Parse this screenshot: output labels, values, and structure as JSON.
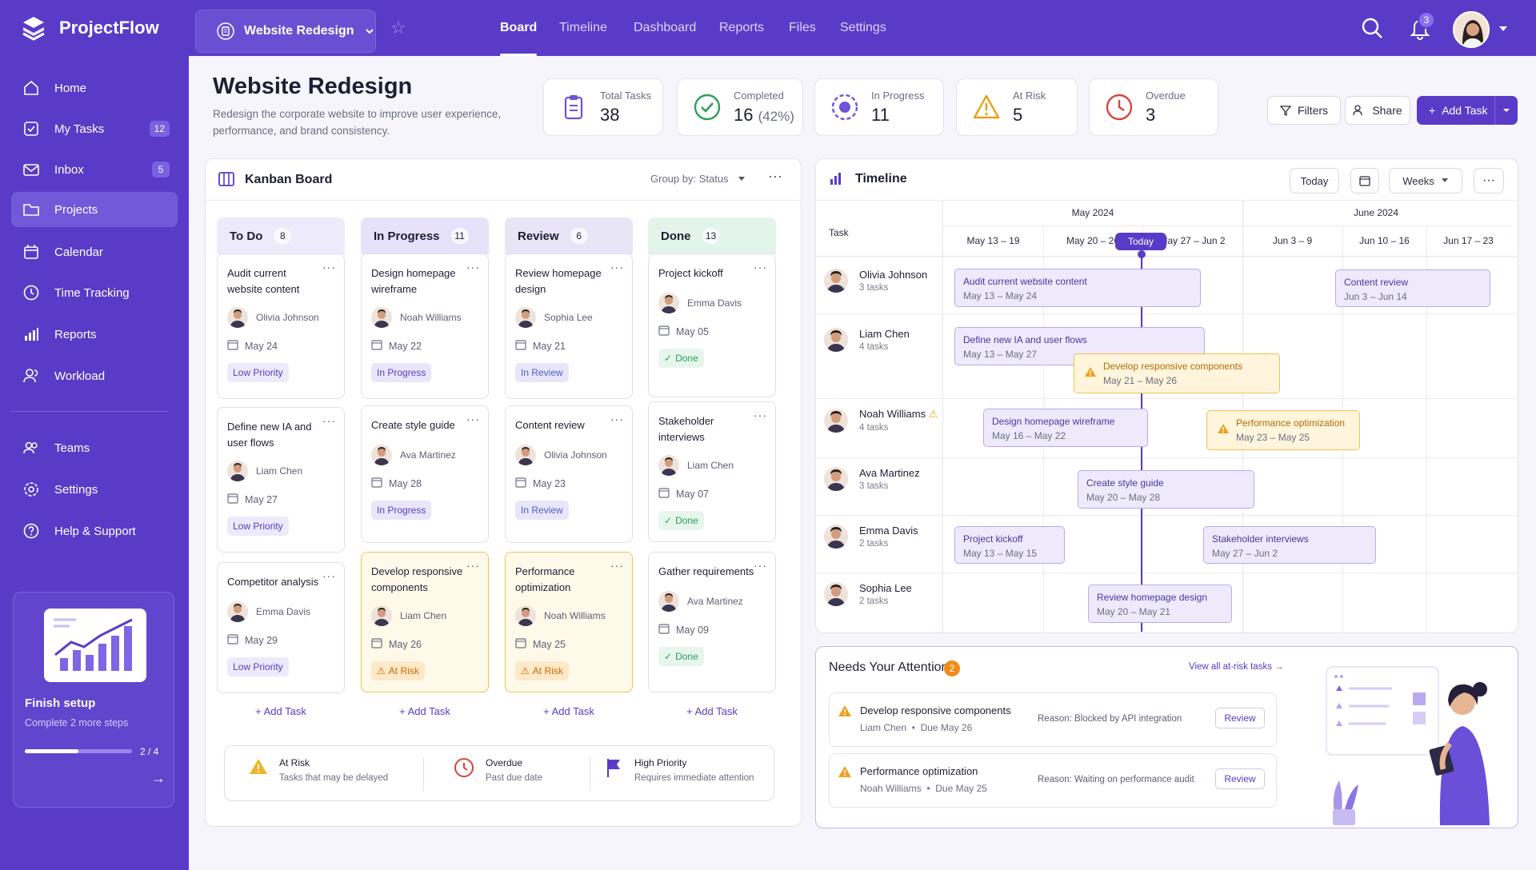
{
  "app": {
    "name": "ProjectFlow",
    "project": "Website Redesign"
  },
  "nav": [
    {
      "label": "Board",
      "active": true
    },
    {
      "label": "Timeline"
    },
    {
      "label": "Dashboard"
    },
    {
      "label": "Reports"
    },
    {
      "label": "Files"
    },
    {
      "label": "Settings"
    }
  ],
  "notifications": {
    "count": "3"
  },
  "sidebar": {
    "items": [
      {
        "label": "Home",
        "icon": "home-icon"
      },
      {
        "label": "My Tasks",
        "icon": "check-square-icon",
        "count": "12"
      },
      {
        "label": "Inbox",
        "icon": "mail-icon",
        "count": "5"
      },
      {
        "label": "Projects",
        "icon": "folder-icon",
        "active": true
      },
      {
        "label": "Calendar",
        "icon": "calendar-icon"
      },
      {
        "label": "Time Tracking",
        "icon": "clock-icon"
      },
      {
        "label": "Reports",
        "icon": "bar-chart-icon"
      },
      {
        "label": "Workload",
        "icon": "users-icon"
      }
    ],
    "secondary": [
      {
        "label": "Teams",
        "icon": "team-icon"
      },
      {
        "label": "Settings",
        "icon": "gear-icon"
      },
      {
        "label": "Help & Support",
        "icon": "help-icon"
      }
    ],
    "setup": {
      "title": "Finish setup",
      "subtitle": "Complete 2 more steps",
      "progress_text": "2 / 4",
      "progress": 0.5
    }
  },
  "header": {
    "title": "Website Redesign",
    "description": "Redesign the corporate website to improve user experience, performance, and brand consistency.",
    "filters_label": "Filters",
    "share_label": "Share",
    "add_task_label": "Add Task"
  },
  "stats": [
    {
      "label": "Total Tasks",
      "value": "38",
      "icon": "clipboard-icon"
    },
    {
      "label": "Completed",
      "value": "16",
      "extra": "(42%)",
      "icon": "check-circle-icon"
    },
    {
      "label": "In Progress",
      "value": "11",
      "icon": "progress-circle-icon"
    },
    {
      "label": "At Risk",
      "value": "5",
      "icon": "warning-icon"
    },
    {
      "label": "Overdue",
      "value": "3",
      "icon": "overdue-clock-icon"
    }
  ],
  "kanban": {
    "title": "Kanban Board",
    "group_by": "Group by: Status",
    "add_task": "+ Add Task",
    "columns": [
      {
        "name": "To Do",
        "count": "8",
        "color": "#eceafb",
        "cards": [
          {
            "title": "Audit current website content",
            "assignee": "Olivia Johnson",
            "due": "May 24",
            "tag": "Low Priority",
            "tag_type": "low"
          },
          {
            "title": "Define new IA and user flows",
            "assignee": "Liam Chen",
            "due": "May 27",
            "tag": "Low Priority",
            "tag_type": "low"
          },
          {
            "title": "Competitor analysis",
            "assignee": "Emma Davis",
            "due": "May 29",
            "tag": "Low Priority",
            "tag_type": "low"
          }
        ]
      },
      {
        "name": "In Progress",
        "count": "11",
        "color": "#e6e2fa",
        "cards": [
          {
            "title": "Design homepage wireframe",
            "assignee": "Noah Williams",
            "due": "May 22",
            "tag": "In Progress",
            "tag_type": "prog"
          },
          {
            "title": "Create style guide",
            "assignee": "Ava Martinez",
            "due": "May 28",
            "tag": "In Progress",
            "tag_type": "prog"
          },
          {
            "title": "Develop responsive components",
            "assignee": "Liam Chen",
            "due": "May 26",
            "tag": "At Risk",
            "tag_type": "risk"
          }
        ]
      },
      {
        "name": "Review",
        "count": "6",
        "color": "#e8e5f7",
        "cards": [
          {
            "title": "Review homepage design",
            "assignee": "Sophia Lee",
            "due": "May 21",
            "tag": "In Review",
            "tag_type": "rev"
          },
          {
            "title": "Content review",
            "assignee": "Olivia Johnson",
            "due": "May 23",
            "tag": "In Review",
            "tag_type": "rev"
          },
          {
            "title": "Performance optimization",
            "assignee": "Noah Williams",
            "due": "May 25",
            "tag": "At Risk",
            "tag_type": "risk"
          }
        ]
      },
      {
        "name": "Done",
        "count": "13",
        "color": "#e3f5ea",
        "cards": [
          {
            "title": "Project kickoff",
            "assignee": "Emma Davis",
            "due": "May 05",
            "tag": "Done",
            "tag_type": "done"
          },
          {
            "title": "Stakeholder interviews",
            "assignee": "Liam Chen",
            "due": "May 07",
            "tag": "Done",
            "tag_type": "done"
          },
          {
            "title": "Gather requirements",
            "assignee": "Ava Martinez",
            "due": "May 09",
            "tag": "Done",
            "tag_type": "done"
          }
        ]
      }
    ],
    "legend": [
      {
        "title": "At Risk",
        "desc": "Tasks that may be delayed",
        "icon": "warning-icon"
      },
      {
        "title": "Overdue",
        "desc": "Past due date",
        "icon": "overdue-clock-icon"
      },
      {
        "title": "High Priority",
        "desc": "Requires immediate attention",
        "icon": "flag-icon"
      }
    ]
  },
  "timeline": {
    "title": "Timeline",
    "today_btn": "Today",
    "scale": "Weeks",
    "task_header": "Task",
    "months": [
      "May 2024",
      "June 2024"
    ],
    "weeks": [
      "May 13 – 19",
      "May 20 – 26",
      "May 27 – Jun 2",
      "Jun 3 – 9",
      "Jun 10 – 16",
      "Jun 17 – 23"
    ],
    "today_label": "Today",
    "people": [
      {
        "name": "Olivia Johnson",
        "tasks": "3 tasks"
      },
      {
        "name": "Liam Chen",
        "tasks": "4 tasks"
      },
      {
        "name": "Noah Williams",
        "tasks": "4 tasks",
        "warning": true
      },
      {
        "name": "Ava Martinez",
        "tasks": "3 tasks"
      },
      {
        "name": "Emma Davis",
        "tasks": "2 tasks"
      },
      {
        "name": "Sophia Lee",
        "tasks": "2 tasks"
      }
    ],
    "bars": [
      {
        "title": "Audit current website content",
        "dates": "May 13 – May 24"
      },
      {
        "title": "Content review",
        "dates": "Jun 3 – Jun 14"
      },
      {
        "title": "Define new IA and user flows",
        "dates": "May 13 – May 27"
      },
      {
        "title": "Develop responsive components",
        "dates": "May 21 – May 26",
        "risk": true
      },
      {
        "title": "Design homepage wireframe",
        "dates": "May 16 – May 22"
      },
      {
        "title": "Performance optimization",
        "dates": "May 23 – May 25",
        "risk": true
      },
      {
        "title": "Create style guide",
        "dates": "May 20 – May 28"
      },
      {
        "title": "Project kickoff",
        "dates": "May 13 – May 15"
      },
      {
        "title": "Stakeholder interviews",
        "dates": "May 27 – Jun 2"
      },
      {
        "title": "Review homepage design",
        "dates": "May 20 – May 21"
      }
    ]
  },
  "attention": {
    "title": "Needs Your Attention",
    "count": "2",
    "view_all": "View all at-risk tasks",
    "items": [
      {
        "title": "Develop responsive components",
        "assignee": "Liam Chen",
        "due": "Due May 26",
        "reason": "Reason: Blocked by API integration",
        "action": "Review"
      },
      {
        "title": "Performance optimization",
        "assignee": "Noah Williams",
        "due": "Due May 25",
        "reason": "Reason: Waiting on performance audit",
        "action": "Review"
      }
    ]
  }
}
